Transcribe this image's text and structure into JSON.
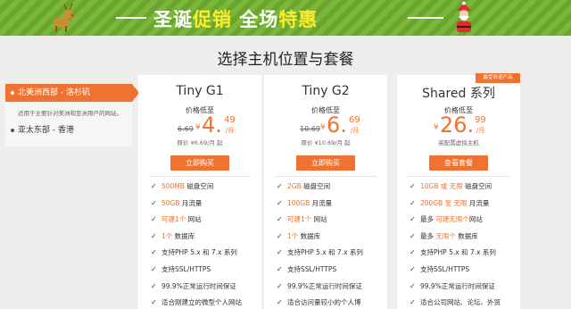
{
  "banner": {
    "part1": "圣诞",
    "part2": "促销",
    "part3": " 全场",
    "part4": "特惠"
  },
  "page_title": "选择主机位置与套餐",
  "regions": {
    "active": "北美洲西部 - 洛杉矶",
    "active_desc": "适用于主要针对美洲和亚洲用户的网站。",
    "other": "亚太东部 - 香港"
  },
  "plans": [
    {
      "name": "Tiny G1",
      "price_label": "价格低至",
      "old_price": "6.69",
      "currency": "¥",
      "price_int": "4.",
      "price_dec": "49",
      "unit": "/月",
      "note": "原价 ¥6.69/月 起",
      "button": "立即购买",
      "features": [
        {
          "hl": "500MB",
          "text": " 磁盘空间"
        },
        {
          "hl": "50GB",
          "text": " 月流量"
        },
        {
          "hl": "可建1个",
          "text": " 网站"
        },
        {
          "hl": "1个",
          "text": " 数据库"
        },
        {
          "hl": "",
          "text": "支持PHP 5.x 和 7.x 系列"
        },
        {
          "hl": "",
          "text": "支持SSL/HTTPS"
        },
        {
          "hl": "",
          "text": "99.9%正常运行时间保证"
        },
        {
          "hl": "",
          "text": "适合刚建立的微型个人网站"
        }
      ]
    },
    {
      "name": "Tiny G2",
      "price_label": "价格低至",
      "old_price": "10.69",
      "currency": "¥",
      "price_int": "6.",
      "price_dec": "69",
      "unit": "/月",
      "note": "原价 ¥10.69/月 起",
      "button": "立即购买",
      "features": [
        {
          "hl": "2GB",
          "text": " 磁盘空间"
        },
        {
          "hl": "100GB",
          "text": " 月流量"
        },
        {
          "hl": "可建1个",
          "text": " 网站"
        },
        {
          "hl": "1个",
          "text": " 数据库"
        },
        {
          "hl": "",
          "text": "支持PHP 5.x 和 7.x 系列"
        },
        {
          "hl": "",
          "text": "支持SSL/HTTPS"
        },
        {
          "hl": "",
          "text": "99.9%正常运行时间保证"
        },
        {
          "hl": "",
          "text": "适合访问量较小的个人博"
        }
      ]
    },
    {
      "name": "Shared 系列",
      "ribbon": "最受欢迎产品",
      "price_label": "价格低至",
      "old_price": "",
      "currency": "¥",
      "price_int": "26.",
      "price_dec": "99",
      "unit": "/月",
      "note": "高配置虚拟主机",
      "button": "查看套餐",
      "features": [
        {
          "hl": "10GB 或 无限",
          "text": " 磁盘空间"
        },
        {
          "hl": "200GB 至 无限",
          "text": " 月流量"
        },
        {
          "hl": "",
          "text": "最多 ",
          "hl2": "可建无限个",
          "text2": "网站"
        },
        {
          "hl": "",
          "text": "最多 ",
          "hl2": "无限个",
          "text2": " 数据库"
        },
        {
          "hl": "",
          "text": "支持PHP 5.x 和 7.x 系列"
        },
        {
          "hl": "",
          "text": "支持SSL/HTTPS"
        },
        {
          "hl": "",
          "text": "99.9%正常运行时间保证"
        },
        {
          "hl": "",
          "text": "适合公司网站、论坛、外贸"
        }
      ]
    }
  ],
  "colors": {
    "accent": "#f07230",
    "banner_green": "#7bb83a",
    "banner_highlight": "#ffeb2a"
  }
}
